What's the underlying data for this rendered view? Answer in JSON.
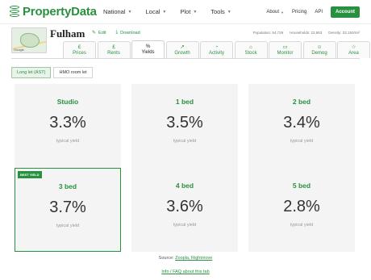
{
  "brand": {
    "name": "PropertyData",
    "color": "#27913f"
  },
  "nav": {
    "main": [
      {
        "label": "National"
      },
      {
        "label": "Local"
      },
      {
        "label": "Plot"
      },
      {
        "label": "Tools"
      }
    ],
    "right": {
      "about": "About",
      "pricing": "Pricing",
      "api": "API",
      "account": "Account"
    }
  },
  "location": {
    "name": "Fulham",
    "map_attribution": "Google",
    "edit_label": "Edit",
    "download_label": "Download",
    "stats": {
      "population": "Population: 54,729",
      "households": "Households: 23,863",
      "density": "Density: 33,150/mi²"
    }
  },
  "tabs": [
    {
      "icon": "£",
      "label": "Prices",
      "name": "prices"
    },
    {
      "icon": "£",
      "label": "Rents",
      "name": "rents"
    },
    {
      "icon": "%",
      "label": "Yields",
      "name": "yields"
    },
    {
      "icon": "↗",
      "label": "Growth",
      "name": "growth"
    },
    {
      "icon": "◔",
      "label": "Activity",
      "name": "activity"
    },
    {
      "icon": "⌂",
      "label": "Stock",
      "name": "stock"
    },
    {
      "icon": "▭",
      "label": "Monitor",
      "name": "monitor"
    },
    {
      "icon": "☺",
      "label": "Demog",
      "name": "demog"
    },
    {
      "icon": "☆",
      "label": "Area",
      "name": "area"
    }
  ],
  "active_tab": "Yields",
  "toggles": {
    "long_let": "Long let (AST)",
    "hmo": "HMO room let"
  },
  "cards": [
    {
      "label": "Studio",
      "value": "3.3%",
      "sub": "typical yield"
    },
    {
      "label": "1 bed",
      "value": "3.5%",
      "sub": "typical yield"
    },
    {
      "label": "2 bed",
      "value": "3.4%",
      "sub": "typical yield"
    },
    {
      "label": "3 bed",
      "value": "3.7%",
      "sub": "typical yield",
      "badge": "BEST YIELD"
    },
    {
      "label": "4 bed",
      "value": "3.6%",
      "sub": "typical yield"
    },
    {
      "label": "5 bed",
      "value": "2.8%",
      "sub": "typical yield"
    }
  ],
  "footer": {
    "source_prefix": "Source:",
    "source_links": "Zoopla, Rightmove",
    "faq": "Info / FAQ about this tab"
  }
}
